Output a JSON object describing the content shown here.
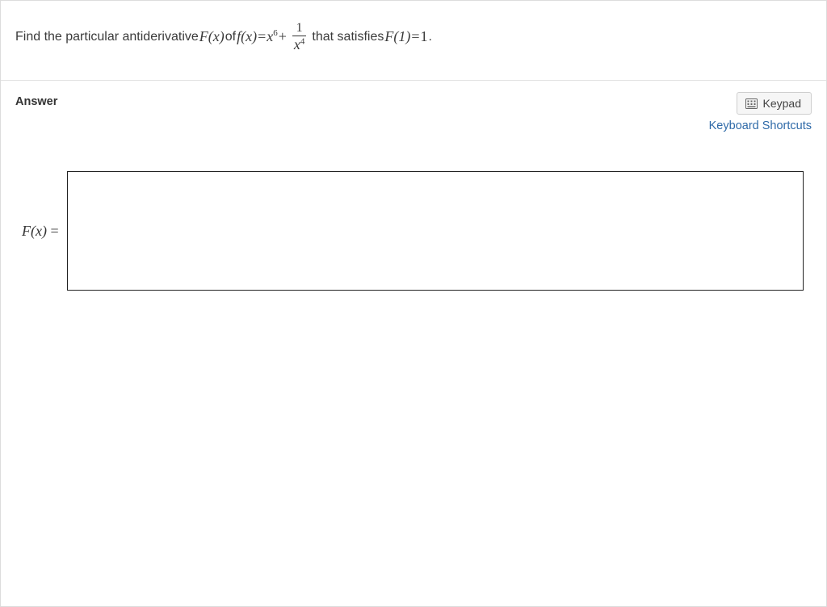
{
  "question": {
    "prefix_text": "Find the particular antiderivative ",
    "F_of_x": "F(x)",
    "of_text": " of ",
    "f_of_x": "f(x)",
    "equals1": " = ",
    "rhs_base": "x",
    "rhs_exp": "6",
    "plus": " + ",
    "frac_num": "1",
    "frac_den_base": "x",
    "frac_den_exp": "4",
    "mid_text": " that satisfies ",
    "F_of_1": "F(1)",
    "equals2": " = ",
    "one": "1",
    "period": "."
  },
  "answer": {
    "heading": "Answer",
    "keypad_label": "Keypad",
    "shortcuts_label": "Keyboard Shortcuts",
    "input_prefix_F": "F(x)",
    "input_prefix_eq": " = ",
    "input_value": ""
  }
}
